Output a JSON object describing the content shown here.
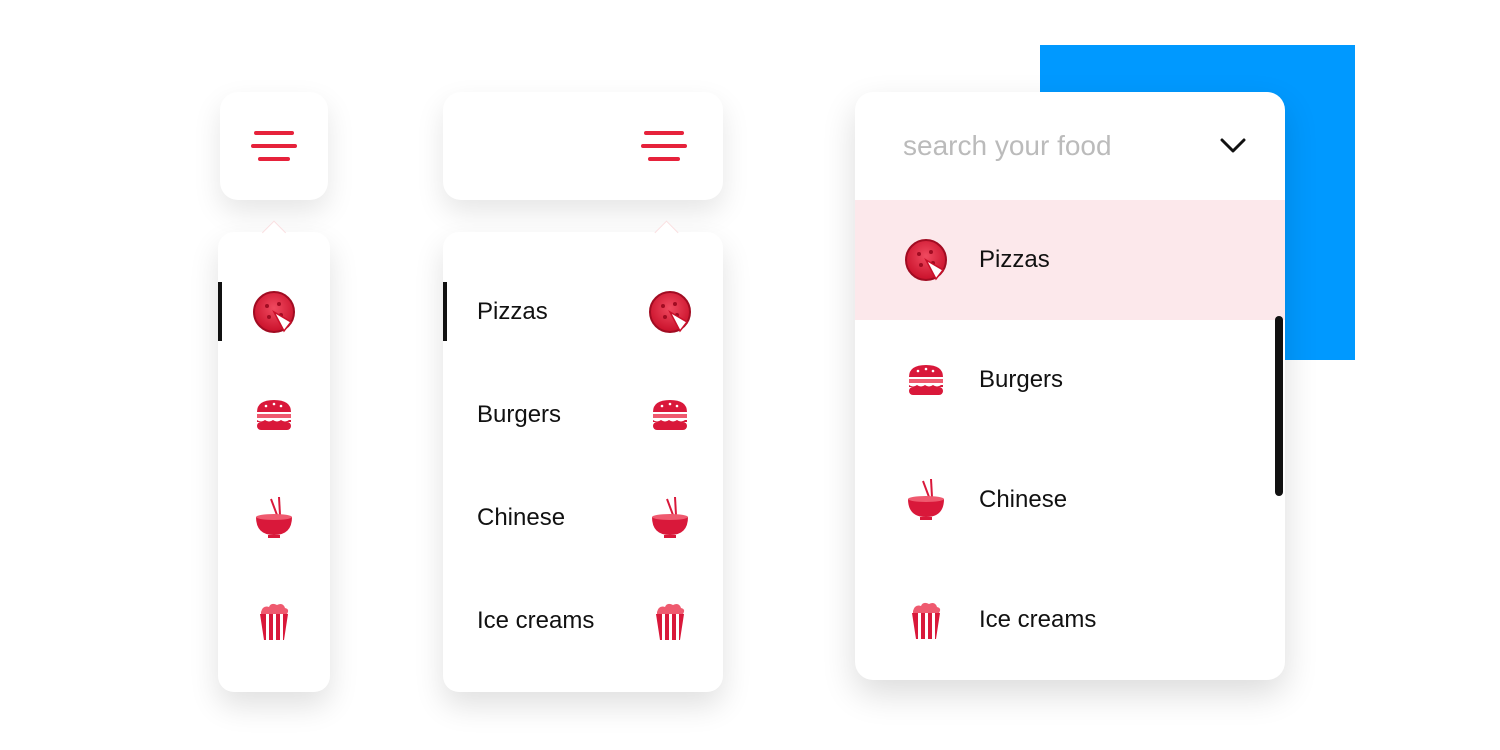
{
  "colors": {
    "accent": "#e6223b",
    "selected_bg": "#fce8eb",
    "blue_block": "#0099ff"
  },
  "search": {
    "placeholder": "search your food"
  },
  "items": [
    {
      "id": "pizzas",
      "label": "Pizzas",
      "icon": "pizza-icon",
      "selected": true
    },
    {
      "id": "burgers",
      "label": "Burgers",
      "icon": "burger-icon",
      "selected": false
    },
    {
      "id": "chinese",
      "label": "Chinese",
      "icon": "bowl-icon",
      "selected": false
    },
    {
      "id": "icecreams",
      "label": "Ice creams",
      "icon": "popcorn-icon",
      "selected": false
    }
  ]
}
